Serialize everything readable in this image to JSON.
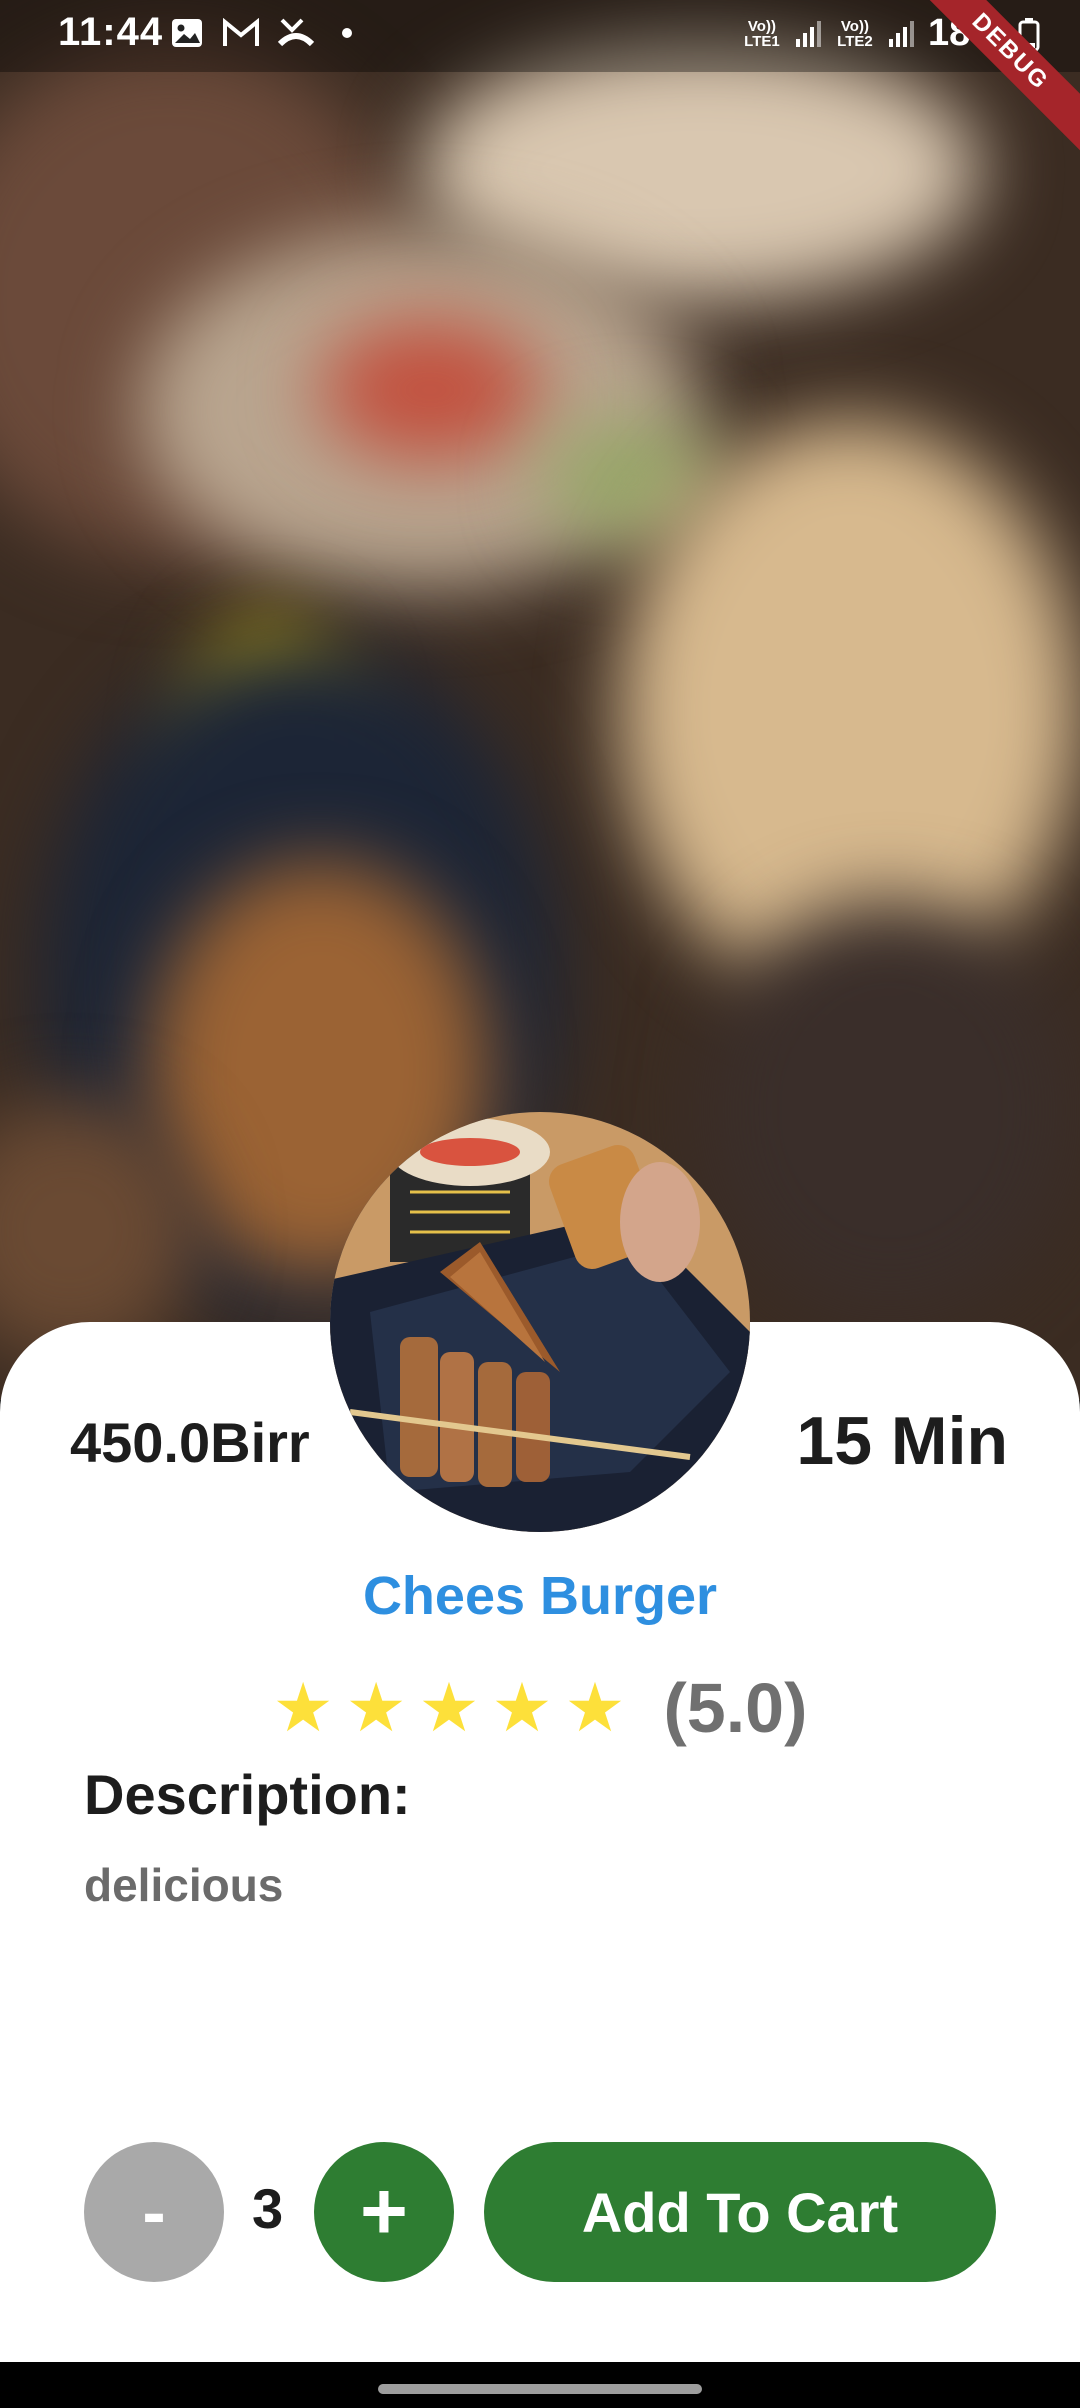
{
  "status_bar": {
    "time": "11:44",
    "sim1": "Vo)) LTE1",
    "sim2": "Vo)) LTE2",
    "battery": "18%"
  },
  "debug_banner": "DEBUG",
  "product": {
    "price": "450.0Birr",
    "duration": "15 Min",
    "name": "Chees Burger",
    "rating_stars": 5,
    "rating_text": "(5.0)",
    "description_label": "Description:",
    "description": "delicious"
  },
  "cart": {
    "minus_label": "-",
    "quantity": "3",
    "plus_label": "+",
    "add_label": "Add To Cart"
  },
  "colors": {
    "accent_green": "#2e7d32",
    "title_blue": "#2e8fe0",
    "star_yellow": "#fde03a",
    "minus_grey": "#a9a9a9"
  },
  "icons": [
    "gallery-icon",
    "gmail-icon",
    "missed-call-icon",
    "dot-icon",
    "signal-icon",
    "battery-icon",
    "star-icon"
  ]
}
